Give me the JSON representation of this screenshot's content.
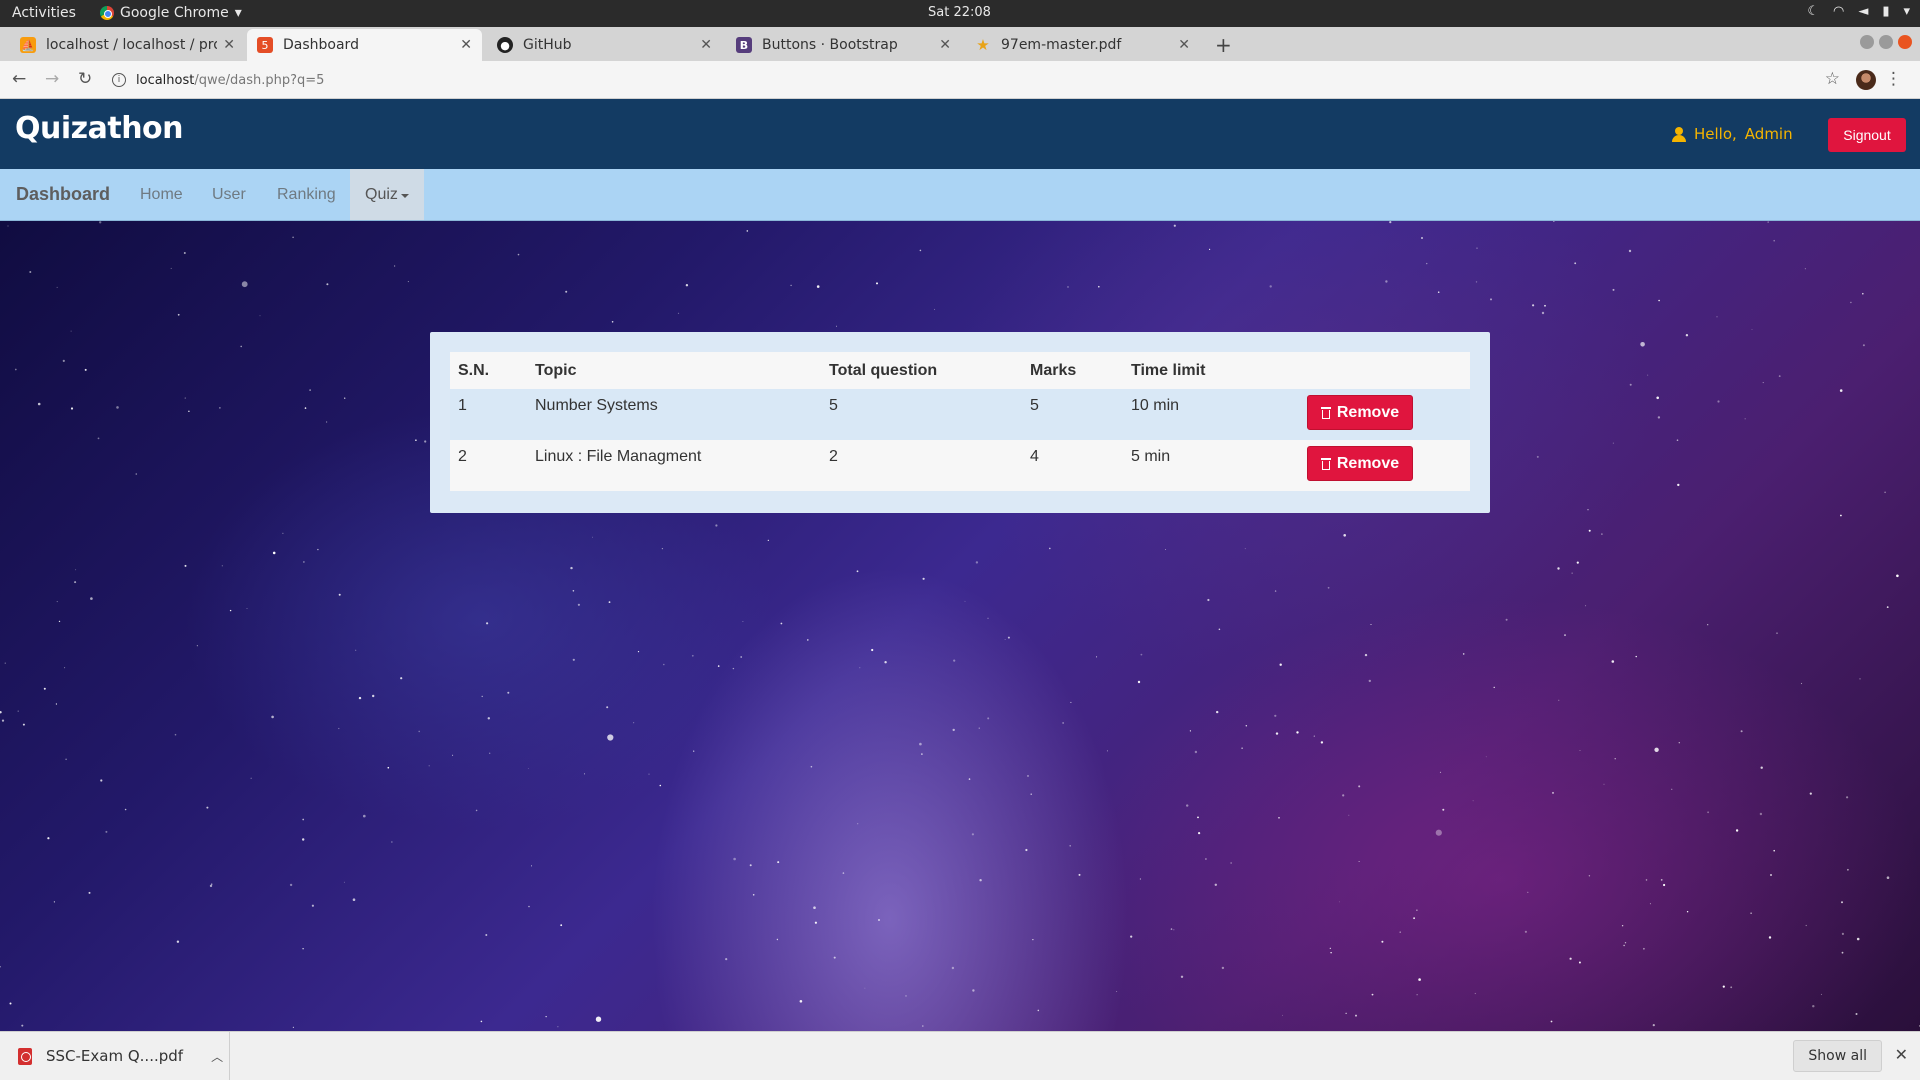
{
  "system": {
    "activities": "Activities",
    "app_name": "Google Chrome",
    "clock": "Sat 22:08"
  },
  "tabs": [
    {
      "title": "localhost / localhost / pro",
      "icon": "phpmyadmin-icon",
      "active": false
    },
    {
      "title": "Dashboard",
      "icon": "html-icon",
      "active": true
    },
    {
      "title": "GitHub",
      "icon": "github-icon",
      "active": false
    },
    {
      "title": "Buttons · Bootstrap",
      "icon": "bootstrap-icon",
      "active": false
    },
    {
      "title": "97em-master.pdf",
      "icon": "star-favicon",
      "active": false
    }
  ],
  "address": {
    "host": "localhost",
    "path": "/qwe/dash.php?q=5"
  },
  "site": {
    "logo": "Quizathon",
    "hello": "Hello,",
    "user": "Admin",
    "signout": "Signout"
  },
  "nav": {
    "brand": "Dashboard",
    "items": [
      "Home",
      "User",
      "Ranking"
    ],
    "dropdown": "Quiz"
  },
  "quiz_table": {
    "headers": [
      "S.N.",
      "Topic",
      "Total question",
      "Marks",
      "Time limit"
    ],
    "rows": [
      {
        "sn": "1",
        "topic": "Number Systems",
        "total": "5",
        "marks": "5",
        "time": "10 min",
        "action": "Remove"
      },
      {
        "sn": "2",
        "topic": "Linux : File Managment",
        "total": "2",
        "marks": "4",
        "time": "5 min",
        "action": "Remove"
      }
    ]
  },
  "downloads": {
    "file": "SSC-Exam Q....pdf",
    "show_all": "Show all"
  },
  "colors": {
    "header_bg": "#133b63",
    "nav_bg": "#abd4f4",
    "danger": "#e0153e",
    "hello_text": "#f5b400"
  }
}
